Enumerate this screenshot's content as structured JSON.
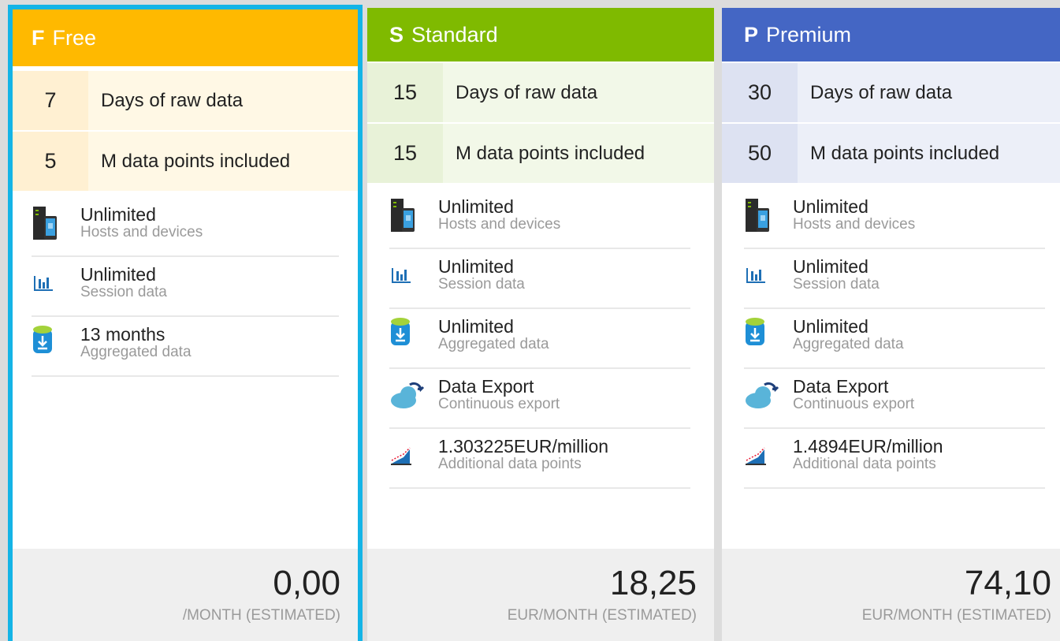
{
  "tiers": [
    {
      "letter": "F",
      "name": "Free",
      "header_color": "#ffb900",
      "stat_num_bg": "#fff0d2",
      "stat_label_bg": "#fff8e5",
      "stats": [
        {
          "num": "7",
          "label": "Days of raw data"
        },
        {
          "num": "5",
          "label": "M data points included"
        }
      ],
      "features": [
        {
          "icon": "server-device-icon",
          "value": "Unlimited",
          "desc": "Hosts and devices"
        },
        {
          "icon": "bar-chart-icon",
          "value": "Unlimited",
          "desc": "Session data"
        },
        {
          "icon": "database-download-icon",
          "value": "13 months",
          "desc": "Aggregated data"
        }
      ],
      "price": "0,00",
      "price_unit": "/MONTH (ESTIMATED)"
    },
    {
      "letter": "S",
      "name": "Standard",
      "header_color": "#7fba00",
      "stat_num_bg": "#e8f2d8",
      "stat_label_bg": "#f2f8e8",
      "stats": [
        {
          "num": "15",
          "label": "Days of raw data"
        },
        {
          "num": "15",
          "label": "M data points included"
        }
      ],
      "features": [
        {
          "icon": "server-device-icon",
          "value": "Unlimited",
          "desc": "Hosts and devices"
        },
        {
          "icon": "bar-chart-icon",
          "value": "Unlimited",
          "desc": "Session data"
        },
        {
          "icon": "database-download-icon",
          "value": "Unlimited",
          "desc": "Aggregated data"
        },
        {
          "icon": "cloud-export-icon",
          "value": "Data Export",
          "desc": "Continuous export"
        },
        {
          "icon": "area-chart-icon",
          "value": "1.303225EUR/million",
          "desc": "Additional data points"
        }
      ],
      "price": "18,25",
      "price_unit": "EUR/MONTH (ESTIMATED)"
    },
    {
      "letter": "P",
      "name": "Premium",
      "header_color": "#4466c4",
      "stat_num_bg": "#dde2f2",
      "stat_label_bg": "#eceff8",
      "stats": [
        {
          "num": "30",
          "label": "Days of raw data"
        },
        {
          "num": "50",
          "label": "M data points included"
        }
      ],
      "features": [
        {
          "icon": "server-device-icon",
          "value": "Unlimited",
          "desc": "Hosts and devices"
        },
        {
          "icon": "bar-chart-icon",
          "value": "Unlimited",
          "desc": "Session data"
        },
        {
          "icon": "database-download-icon",
          "value": "Unlimited",
          "desc": "Aggregated data"
        },
        {
          "icon": "cloud-export-icon",
          "value": "Data Export",
          "desc": "Continuous export"
        },
        {
          "icon": "area-chart-icon",
          "value": "1.4894EUR/million",
          "desc": "Additional data points"
        }
      ],
      "price": "74,10",
      "price_unit": "EUR/MONTH (ESTIMATED)"
    }
  ],
  "selected_tier": "Free",
  "selection_color": "#14b4e6"
}
